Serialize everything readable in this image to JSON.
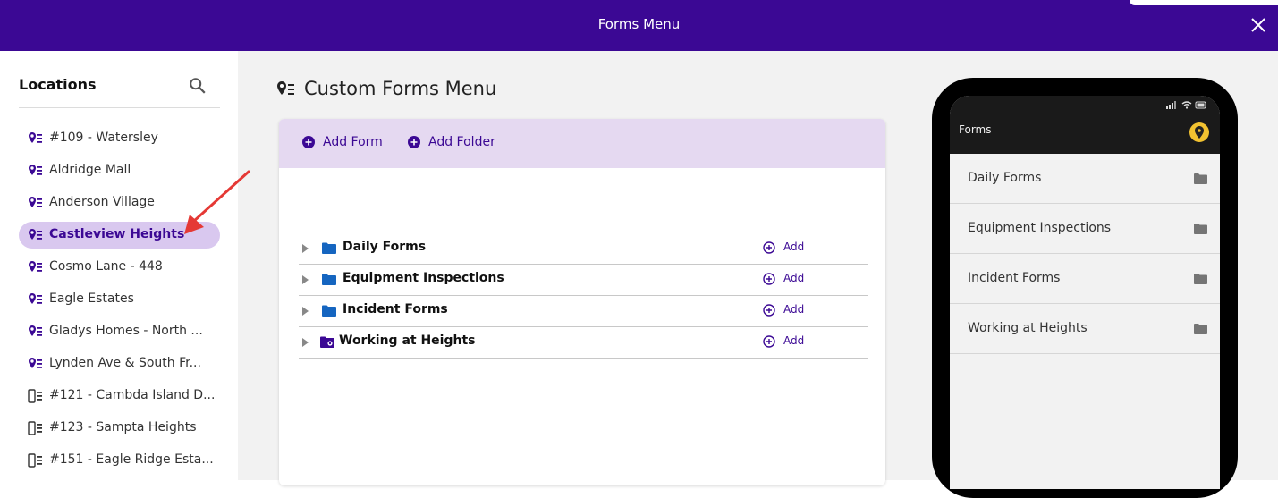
{
  "window": {
    "title": "Forms Menu"
  },
  "sidebar": {
    "heading": "Locations",
    "items": [
      {
        "label": "#109 - Watersley",
        "icon": "location-list-icon"
      },
      {
        "label": "Aldridge Mall",
        "icon": "location-list-icon"
      },
      {
        "label": "Anderson Village",
        "icon": "location-list-icon"
      },
      {
        "label": "Castleview Heights",
        "icon": "location-list-icon",
        "selected": true
      },
      {
        "label": "Cosmo Lane - 448",
        "icon": "location-list-icon"
      },
      {
        "label": "Eagle Estates",
        "icon": "location-list-icon"
      },
      {
        "label": "Gladys Homes - North ...",
        "icon": "location-list-icon"
      },
      {
        "label": "Lynden Ave & South Fr...",
        "icon": "location-list-icon"
      },
      {
        "label": "#121 - Cambda Island D...",
        "icon": "device-list-icon"
      },
      {
        "label": "#123 - Sampta Heights",
        "icon": "device-list-icon"
      },
      {
        "label": "#151 - Eagle Ridge Esta...",
        "icon": "device-list-icon"
      }
    ]
  },
  "main": {
    "title": "Custom Forms Menu",
    "toolbar": {
      "add_form": "Add Form",
      "add_folder": "Add Folder"
    },
    "rows": [
      {
        "name": "Daily Forms",
        "add": "Add",
        "icon": "folder-icon"
      },
      {
        "name": "Equipment Inspections",
        "add": "Add",
        "icon": "folder-icon"
      },
      {
        "name": "Incident Forms",
        "add": "Add",
        "icon": "folder-icon"
      },
      {
        "name": "Working at Heights",
        "add": "Add",
        "icon": "location-folder-icon"
      }
    ]
  },
  "phone": {
    "header_title": "Forms",
    "items": [
      "Daily Forms",
      "Equipment Inspections",
      "Incident Forms",
      "Working at Heights"
    ]
  },
  "colors": {
    "brand": "#3b0894",
    "selected_bg": "#d9c8ef",
    "toolbar_bg": "#e5d9f1",
    "folder_blue": "#1565c0",
    "pin_yellow": "#f2c230",
    "arrow_red": "#e53935"
  }
}
